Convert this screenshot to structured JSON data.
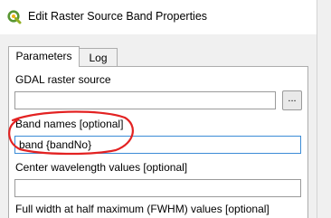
{
  "window": {
    "title": "Edit Raster Source Band Properties",
    "app_icon": "qgis-icon"
  },
  "tabs": [
    {
      "label": "Parameters",
      "active": true
    },
    {
      "label": "Log",
      "active": false
    }
  ],
  "fields": {
    "gdal_source": {
      "label": "GDAL raster source",
      "value": "",
      "browse_label": "..."
    },
    "band_names": {
      "label": "Band names [optional]",
      "value": "band {bandNo}"
    },
    "center_wavelength": {
      "label": "Center wavelength values [optional]",
      "value": ""
    },
    "fwhm": {
      "label": "Full width at half maximum (FWHM) values [optional]"
    }
  },
  "annotation": {
    "color": "#e32222"
  }
}
